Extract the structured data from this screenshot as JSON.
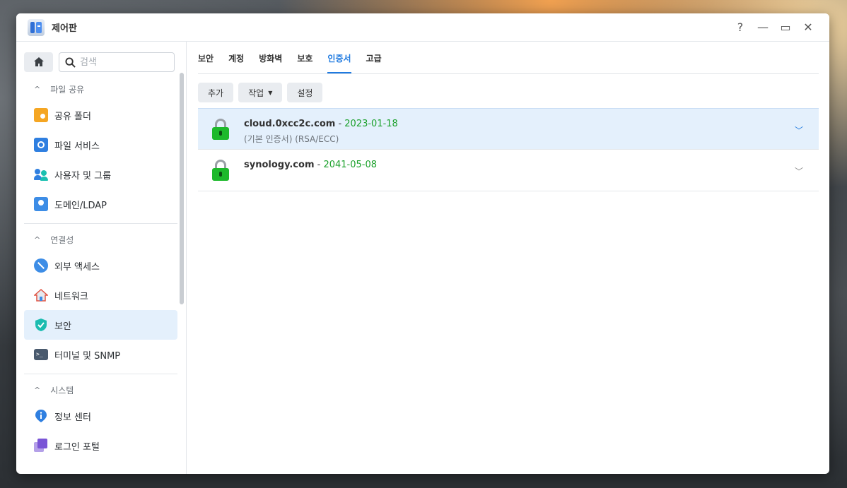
{
  "window": {
    "title": "제어판",
    "help": "?",
    "minimize": "—",
    "maximize": "▭",
    "close": "✕"
  },
  "search": {
    "placeholder": "검색"
  },
  "sidebar": {
    "sections": [
      {
        "title": "파일 공유",
        "items": [
          "공유 폴더",
          "파일 서비스",
          "사용자 및 그룹",
          "도메인/LDAP"
        ]
      },
      {
        "title": "연결성",
        "items": [
          "외부 액세스",
          "네트워크",
          "보안",
          "터미널 및 SNMP"
        ]
      },
      {
        "title": "시스템",
        "items": [
          "정보 센터",
          "로그인 포털"
        ]
      }
    ],
    "active_item": "보안"
  },
  "tabs": [
    "보안",
    "계정",
    "방화벽",
    "보호",
    "인증서",
    "고급"
  ],
  "active_tab": "인증서",
  "toolbar": {
    "add": "추가",
    "action": "작업",
    "settings": "설정"
  },
  "certificates": [
    {
      "domain": "cloud.0xcc2c.com",
      "separator": " - ",
      "date": "2023-01-18",
      "sub": "(기본 인증서) (RSA/ECC)",
      "selected": true
    },
    {
      "domain": "synology.com",
      "separator": " - ",
      "date": "2041-05-08",
      "sub": "",
      "selected": false
    }
  ],
  "colors": {
    "accent": "#1f7ae0",
    "lock_green": "#1db92b",
    "date_green": "#1aa02a",
    "selected_bg": "#e4f0fc"
  }
}
